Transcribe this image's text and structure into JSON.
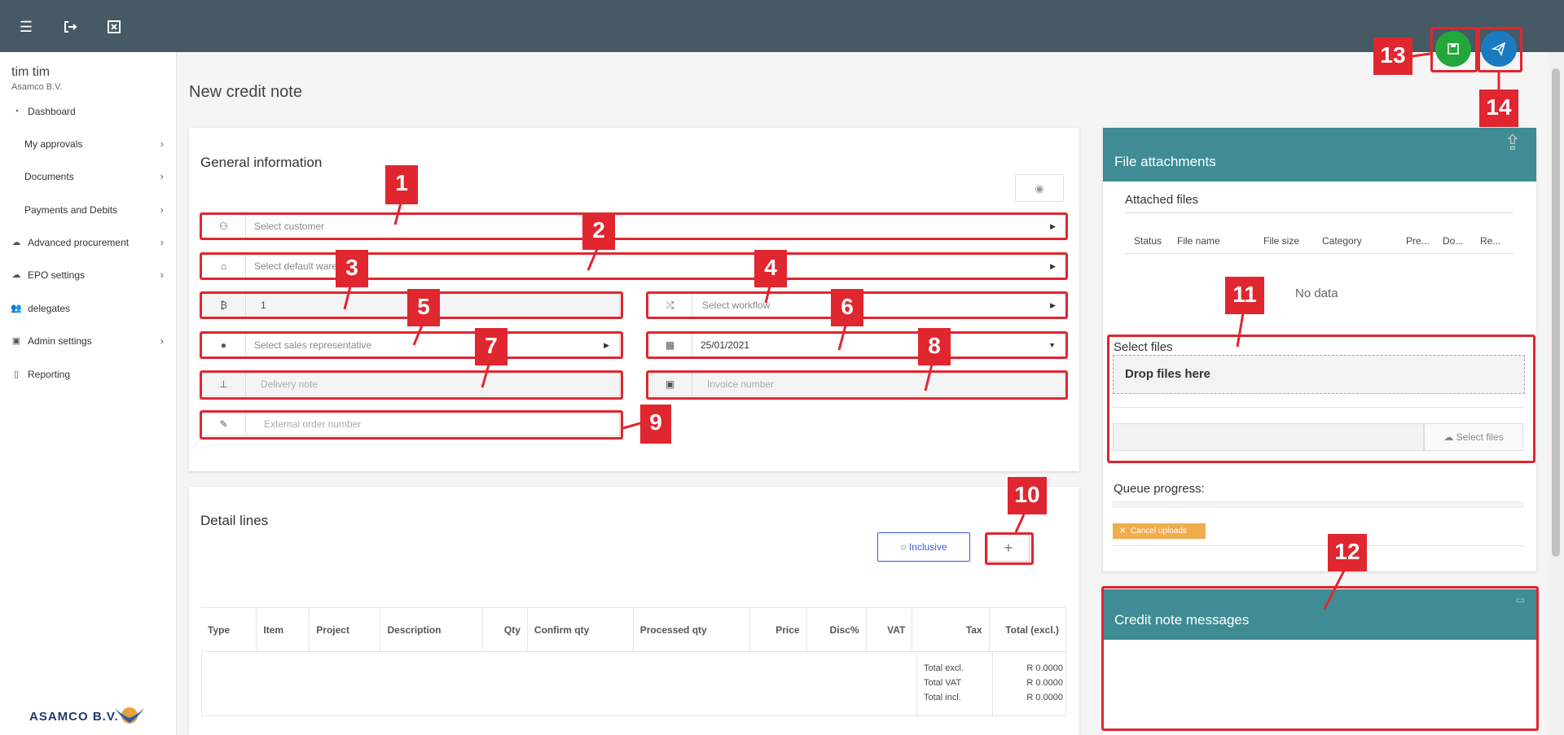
{
  "user": {
    "name": "tim tim",
    "company": "Asamco B.V."
  },
  "sidebar": {
    "items": [
      {
        "label": "Dashboard",
        "icon": "dashboard-icon"
      },
      {
        "label": "My approvals",
        "icon": ""
      },
      {
        "label": "Documents",
        "icon": ""
      },
      {
        "label": "Payments and Debits",
        "icon": ""
      },
      {
        "label": "Advanced procurement",
        "icon": "cloud-icon"
      },
      {
        "label": "EPO settings",
        "icon": "cloud-icon"
      },
      {
        "label": "delegates",
        "icon": "users-icon"
      },
      {
        "label": "Admin settings",
        "icon": "briefcase-icon"
      },
      {
        "label": "Reporting",
        "icon": "file-icon"
      }
    ],
    "logo_text": "ASAMCO B.V."
  },
  "page": {
    "title": "New credit note"
  },
  "general": {
    "title": "General information",
    "customer_placeholder": "Select customer",
    "warehouse_placeholder": "Select default warehouse",
    "currency_value": "1",
    "workflow_placeholder": "Select workflow",
    "sales_rep_placeholder": "Select sales representative",
    "date_value": "25/01/2021",
    "delivery_note_placeholder": "Delivery note",
    "invoice_number_placeholder": "Invoice number",
    "external_order_placeholder": "External order number"
  },
  "detail": {
    "title": "Detail lines",
    "inclusive_label": "Inclusive",
    "plus_label": "+",
    "columns": [
      "Type",
      "Item",
      "Project",
      "Description",
      "Qty",
      "Confirm qty",
      "Processed qty",
      "Price",
      "Disc%",
      "VAT",
      "Tax",
      "Total (excl.)"
    ],
    "totals": [
      {
        "label": "Total excl.",
        "value": "R 0.0000"
      },
      {
        "label": "Total VAT",
        "value": "R 0.0000"
      },
      {
        "label": "Total incl.",
        "value": "R 0.0000"
      }
    ]
  },
  "attachments": {
    "title": "File attachments",
    "attached_label": "Attached files",
    "columns": [
      "Status",
      "File name",
      "File size",
      "Category",
      "Pre...",
      "Do...",
      "Re..."
    ],
    "no_data": "No data",
    "select_files_label": "Select files",
    "drop_label": "Drop files here",
    "select_files_btn": "Select files",
    "queue_label": "Queue progress:",
    "cancel_label": "Cancel uploads"
  },
  "messages": {
    "title": "Credit note messages"
  },
  "annotations": [
    "1",
    "2",
    "3",
    "4",
    "5",
    "6",
    "7",
    "8",
    "9",
    "10",
    "11",
    "12",
    "13",
    "14"
  ],
  "colors": {
    "topbar": "#455a64",
    "teal": "#3f8c94",
    "save": "#22a83a",
    "send": "#1a7bc0",
    "annotation": "#e0262f"
  }
}
